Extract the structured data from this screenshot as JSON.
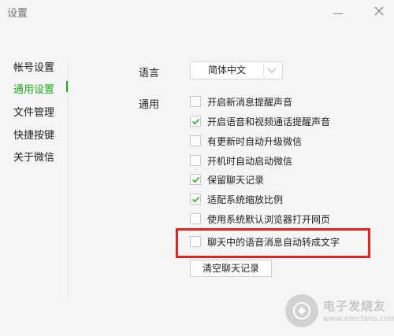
{
  "window": {
    "title": "设置"
  },
  "sidebar": {
    "items": [
      {
        "label": "帐号设置"
      },
      {
        "label": "通用设置",
        "active": true
      },
      {
        "label": "文件管理"
      },
      {
        "label": "快捷按键"
      },
      {
        "label": "关于微信"
      }
    ]
  },
  "general": {
    "language_label": "语言",
    "language_value": "简体中文",
    "section_label": "通用",
    "options": [
      {
        "label": "开启新消息提醒声音",
        "checked": false
      },
      {
        "label": "开启语音和视频通话提醒声音",
        "checked": true
      },
      {
        "label": "有更新时自动升级微信",
        "checked": false
      },
      {
        "label": "开机时自动启动微信",
        "checked": false
      },
      {
        "label": "保留聊天记录",
        "checked": true
      },
      {
        "label": "适配系统缩放比例",
        "checked": true
      },
      {
        "label": "使用系统默认浏览器打开网页",
        "checked": false
      },
      {
        "label": "聊天中的语音消息自动转成文字",
        "checked": false
      }
    ],
    "clear_button": "清空聊天记录"
  },
  "watermark": {
    "title": "电子发烧友",
    "url": "www.elecfans.com"
  },
  "colors": {
    "accent": "#1aad19",
    "highlight": "#e8231d",
    "background": "#f5f5f5"
  }
}
